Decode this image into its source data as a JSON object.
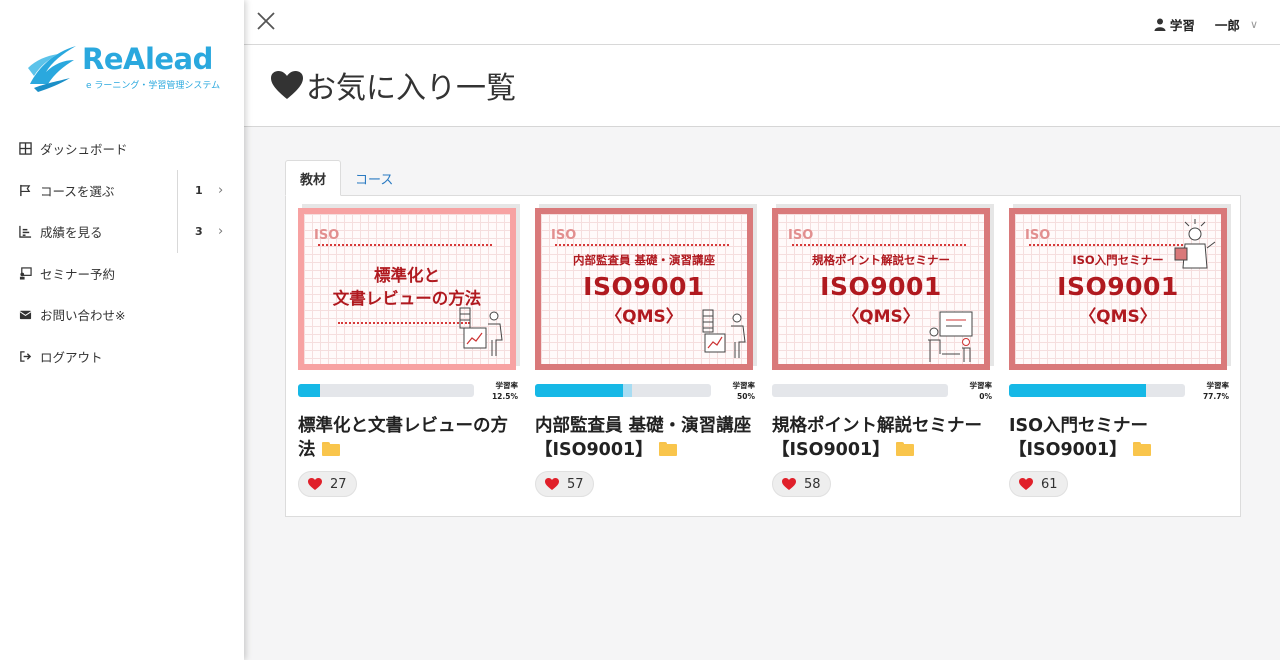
{
  "brand": {
    "name": "ReAlead",
    "subtitle": "e ラーニング・学習管理システム",
    "color": "#2aa8de"
  },
  "sidebar": {
    "items": [
      {
        "label": "ダッシュボード",
        "icon": "grid-icon"
      },
      {
        "label": "コースを選ぶ",
        "icon": "flag-icon",
        "count": "1"
      },
      {
        "label": "成績を見る",
        "icon": "bar-chart-icon",
        "count": "3"
      },
      {
        "label": "セミナー予約",
        "icon": "seminar-icon"
      },
      {
        "label": "お問い合わせ※",
        "icon": "envelope-icon"
      },
      {
        "label": "ログアウト",
        "icon": "sign-out-icon"
      }
    ]
  },
  "topbar": {
    "user_first": "学習",
    "user_last": "一郎"
  },
  "page": {
    "title": "お気に入り一覧"
  },
  "tabs": [
    {
      "label": "教材",
      "active": true
    },
    {
      "label": "コース",
      "active": false
    }
  ],
  "progress_label": "学習率",
  "cards": [
    {
      "thumb_iso": "ISO",
      "thumb_line1": "標準化と",
      "thumb_line2": "文書レビューの方法",
      "thumb_color": "#f7a2a2",
      "progress": 12.5,
      "rate": "12.5%",
      "title": "標準化と文書レビューの方法",
      "likes": "27"
    },
    {
      "thumb_iso": "ISO",
      "thumb_small": "内部監査員 基礎・演習講座",
      "thumb_big": "ISO9001",
      "thumb_qms": "〈QMS〉",
      "thumb_color": "#d9797a",
      "progress": 50,
      "buffer": 55,
      "rate": "50%",
      "title": "内部監査員 基礎・演習講座【ISO9001】",
      "likes": "57"
    },
    {
      "thumb_iso": "ISO",
      "thumb_small": "規格ポイント解説セミナー",
      "thumb_big": "ISO9001",
      "thumb_qms": "〈QMS〉",
      "thumb_color": "#d9797a",
      "progress": 0,
      "rate": "0%",
      "title": "規格ポイント解説セミナー【ISO9001】",
      "likes": "58"
    },
    {
      "thumb_iso": "ISO",
      "thumb_small": "ISO入門セミナー",
      "thumb_big": "ISO9001",
      "thumb_qms": "〈QMS〉",
      "thumb_color": "#d9797a",
      "progress": 77.7,
      "rate": "77.7%",
      "title": "ISO入門セミナー【ISO9001】",
      "likes": "61"
    }
  ],
  "colors": {
    "progress_fill": "#16b8e6",
    "heart": "#e0202a",
    "folder": "#f9c54c"
  }
}
